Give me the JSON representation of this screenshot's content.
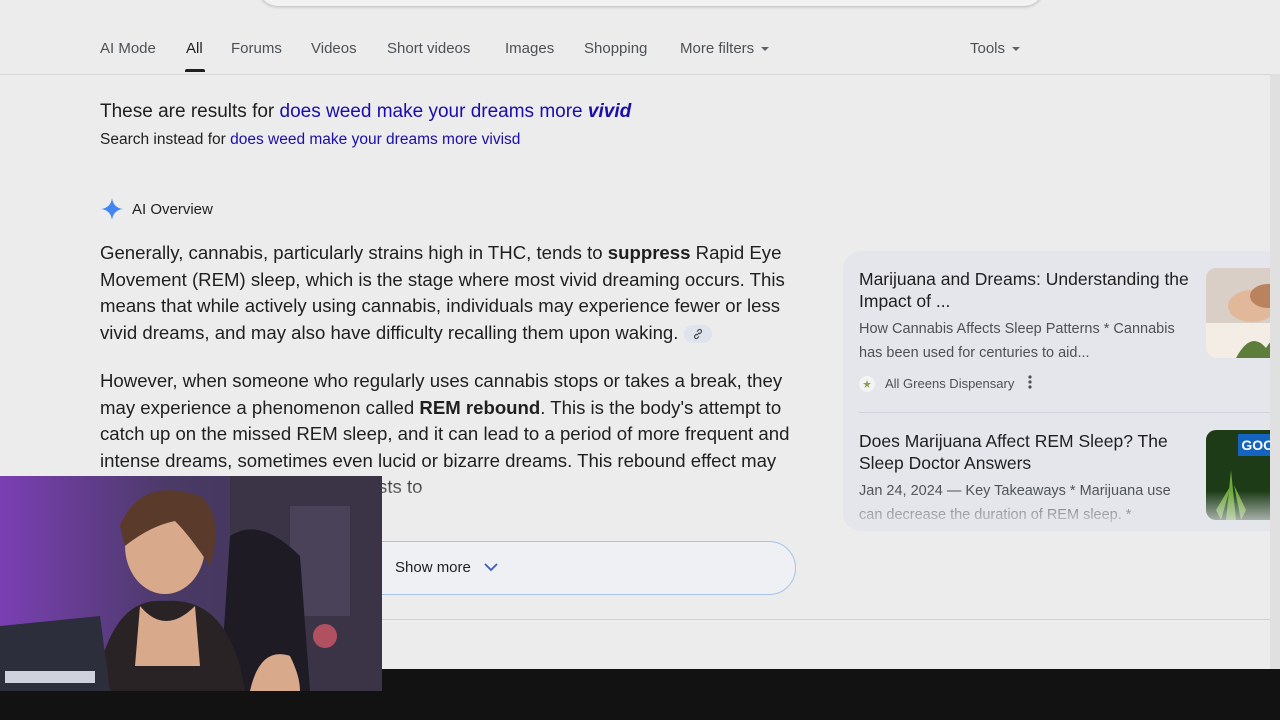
{
  "tabs": [
    {
      "label": "AI Mode",
      "active": false
    },
    {
      "label": "All",
      "active": true
    },
    {
      "label": "Forums",
      "active": false
    },
    {
      "label": "Videos",
      "active": false
    },
    {
      "label": "Short videos",
      "active": false
    },
    {
      "label": "Images",
      "active": false
    },
    {
      "label": "Shopping",
      "active": false
    },
    {
      "label": "More filters",
      "active": false,
      "dropdown": true
    }
  ],
  "tools": {
    "label": "Tools"
  },
  "spelling": {
    "results_prefix": "These are results for ",
    "corrected_query_start": "does weed make your dreams more ",
    "corrected_query_emphasis": "vivid",
    "instead_prefix": "Search instead for ",
    "original_query": "does weed make your dreams more vivisd"
  },
  "ai_overview": {
    "label": "AI Overview",
    "p1": {
      "t1": "Generally, cannabis, particularly strains high in THC, tends to ",
      "b1": "suppress",
      "t2": " Rapid Eye Movement (REM) sleep, which is the stage where most vivid dreaming occurs. This means that while actively using cannabis, individuals may experience fewer or less vivid dreams, and may also have difficulty recalling them upon waking."
    },
    "p2": {
      "t1": "However, when someone who regularly uses cannabis stops or takes a break, they may experience a phenomenon called ",
      "b1": "REM rebound",
      "t2": ". This is the body's attempt to catch up on the missed REM sleep, and it can lead to a period of more frequent and intense dreams, sometimes even lucid or bizarre dreams. This rebound effect may last a few weeks as the body adjusts to"
    },
    "show_more": "Show more"
  },
  "sources": [
    {
      "title": "Marijuana and Dreams: Understanding the Impact of ...",
      "snippet": "How Cannabis Affects Sleep Patterns * Cannabis has been used for centuries to aid...",
      "source": "All Greens Dispensary"
    },
    {
      "title": "Does Marijuana Affect REM Sleep? The Sleep Doctor Answers",
      "snippet": "Jan 24, 2024 — Key Takeaways * Marijuana use can decrease the duration of REM sleep. *",
      "thumb_text": "GOOD?"
    }
  ],
  "colors": {
    "link": "#1a0dab",
    "accent_star": "#4285f4",
    "background": "#ececec"
  }
}
